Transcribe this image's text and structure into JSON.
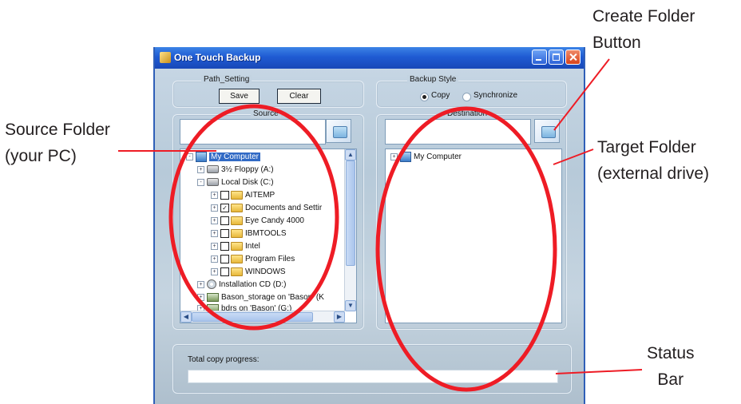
{
  "callouts": {
    "create_folder": [
      "Create Folder",
      "Button"
    ],
    "source_folder": [
      "Source Folder",
      "(your PC)"
    ],
    "target_folder": [
      "Target Folder",
      "(external drive)"
    ],
    "status_bar": [
      "Status",
      "Bar"
    ]
  },
  "window": {
    "title": "One Touch Backup",
    "controls": [
      "minimize",
      "maximize",
      "close"
    ]
  },
  "path_setting": {
    "label": "Path_Setting",
    "save_label": "Save",
    "clear_label": "Clear"
  },
  "backup_style": {
    "label": "Backup Style",
    "options": [
      {
        "label": "Copy",
        "selected": true
      },
      {
        "label": "Synchronize",
        "selected": false
      }
    ]
  },
  "source": {
    "label": "Source",
    "path_value": "",
    "tree": [
      {
        "label": "My Computer",
        "icon": "computer-icon",
        "expander": "-",
        "selected": true
      },
      {
        "label": "3½ Floppy (A:)",
        "icon": "floppy-icon",
        "expander": "+"
      },
      {
        "label": "Local Disk (C:)",
        "icon": "drive-icon",
        "expander": "-"
      },
      {
        "label": "AITEMP",
        "icon": "folder-icon",
        "expander": "+",
        "checked": false
      },
      {
        "label": "Documents and Settir",
        "icon": "folder-icon",
        "expander": "+",
        "checked": true
      },
      {
        "label": "Eye Candy 4000",
        "icon": "folder-icon",
        "expander": "+",
        "checked": false
      },
      {
        "label": "IBMTOOLS",
        "icon": "folder-icon",
        "expander": "+",
        "checked": false
      },
      {
        "label": "Intel",
        "icon": "folder-icon",
        "expander": "+",
        "checked": false
      },
      {
        "label": "Program Files",
        "icon": "folder-icon",
        "expander": "+",
        "checked": false
      },
      {
        "label": "WINDOWS",
        "icon": "folder-icon",
        "expander": "+",
        "checked": false
      },
      {
        "label": "Installation CD (D:)",
        "icon": "cd-icon",
        "expander": "+"
      },
      {
        "label": "Bason_storage on 'Bason' (K",
        "icon": "network-drive-icon",
        "expander": "+"
      },
      {
        "label": "bdrs on 'Bason' (G:)",
        "icon": "network-drive-icon",
        "expander": "+"
      }
    ]
  },
  "destination": {
    "label": "Destination",
    "path_value": "",
    "tree": [
      {
        "label": "My Computer",
        "icon": "computer-icon",
        "expander": "+"
      }
    ]
  },
  "status": {
    "label": "Total copy progress:",
    "progress": 0
  },
  "colors": {
    "annotation_red": "#ee1c25",
    "titlebar_blue": "#1f5bd3",
    "selection_blue": "#316ac5"
  }
}
